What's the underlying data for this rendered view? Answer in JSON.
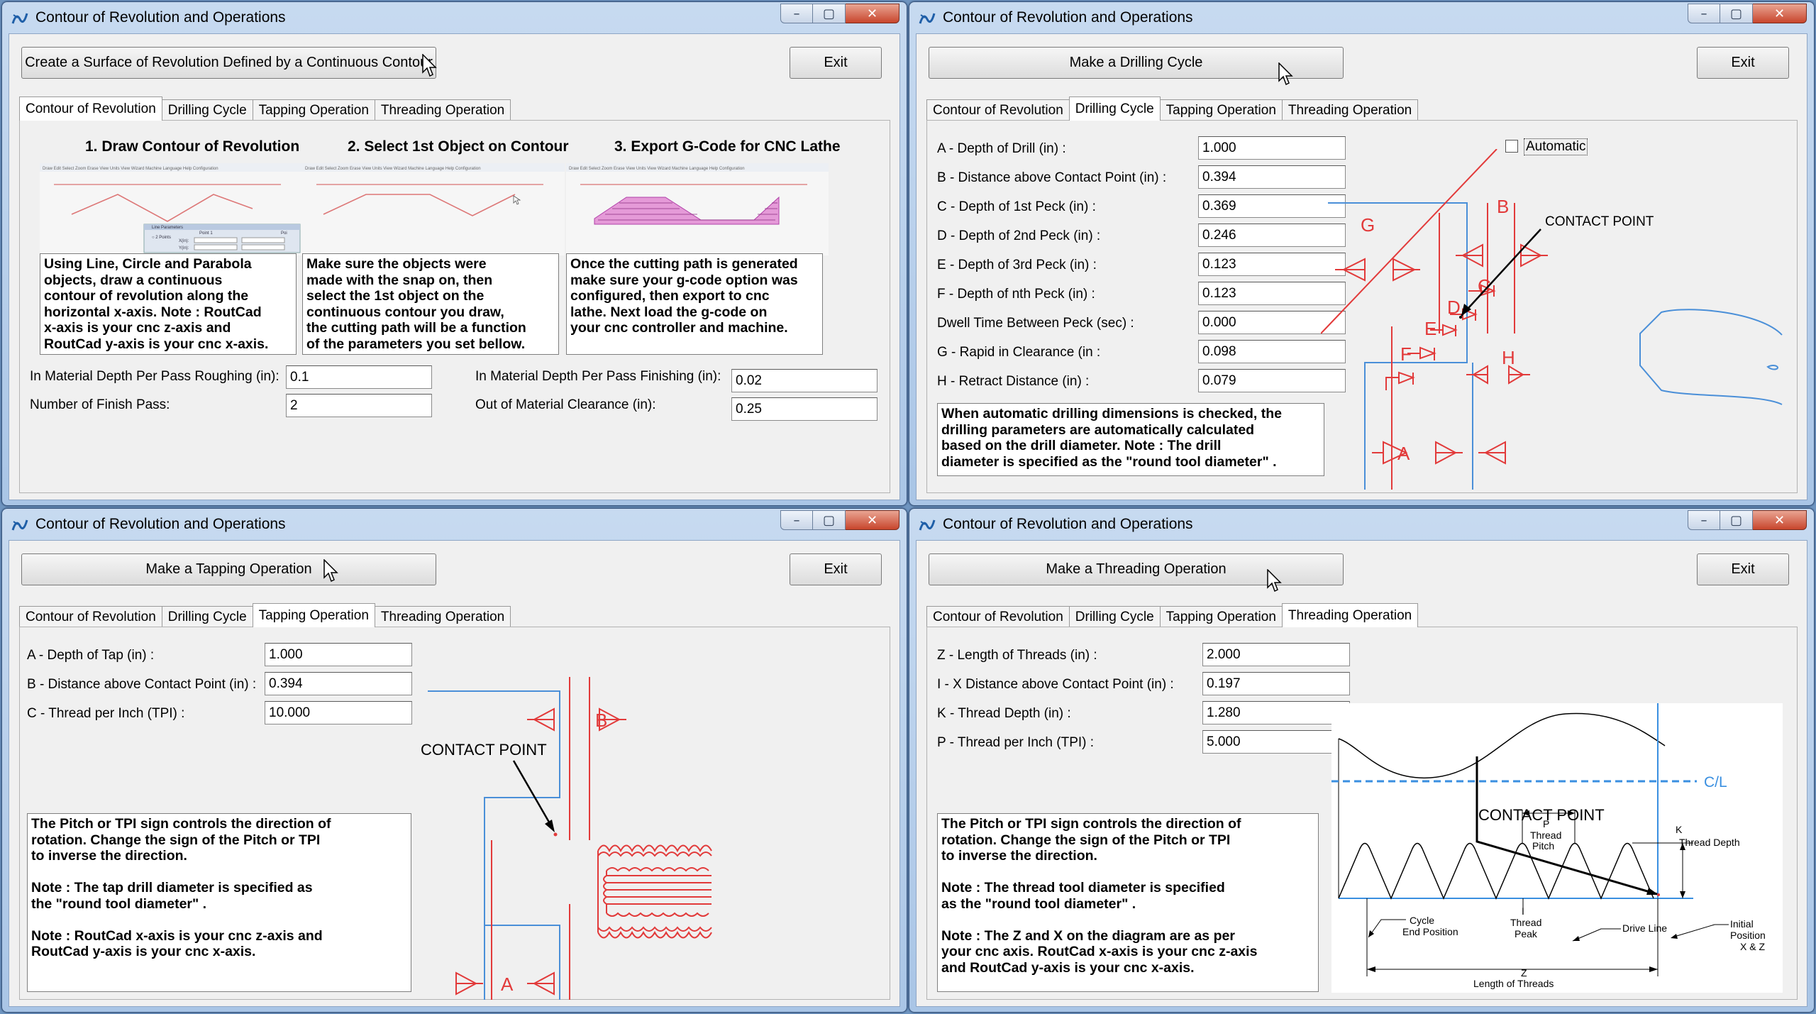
{
  "window_title": "Contour of Revolution and Operations",
  "window_controls": {
    "minimize": "–",
    "maximize": "▢",
    "close": "✕"
  },
  "tabs": [
    "Contour of Revolution",
    "Drilling Cycle",
    "Tapping Operation",
    "Threading Operation"
  ],
  "exit_label": "Exit",
  "contour": {
    "main_button": "Create a Surface of Revolution Defined by a Continuous Contour",
    "steps": [
      {
        "heading": "1. Draw Contour of Revolution",
        "text": "Using Line, Circle and Parabola\nobjects, draw a continuous\ncontour  of revolution along the\nhorizontal x-axis. Note : RoutCad\nx-axis is your cnc z-axis and\nRoutCad y-axis is your cnc x-axis."
      },
      {
        "heading": "2. Select 1st Object on Contour",
        "text": "Make sure the objects were\nmade with the snap on, then\nselect the 1st object on the\ncontinuous contour you draw,\nthe cutting path will be a function\nof the parameters you set bellow."
      },
      {
        "heading": "3. Export G-Code for CNC Lathe",
        "text": "Once the cutting path is generated\nmake sure your g-code option was\nconfigured, then export to cnc\nlathe. Next load the g-code on\nyour cnc controller and machine."
      }
    ],
    "menu_items": [
      "Draw",
      "Edit",
      "Select",
      "Zoom",
      "Erase",
      "View",
      "Units",
      "View",
      "Wizard",
      "Machine",
      "Language",
      "Help",
      "Configuration"
    ],
    "line_params": {
      "title": "Line Parameters",
      "option": "2 Points",
      "col1": "Point 1",
      "col2": "Poi",
      "xlabel": "X(in):",
      "ylabel": "Y(in):"
    },
    "fields": [
      {
        "label": "In Material Depth Per Pass Roughing (in):",
        "value": "0.1"
      },
      {
        "label": "Number of Finish Pass:",
        "value": "2"
      },
      {
        "label": "In Material Depth Per Pass Finishing (in):",
        "value": "0.02"
      },
      {
        "label": "Out of Material Clearance (in):",
        "value": "0.25"
      }
    ]
  },
  "drilling": {
    "main_button": "Make a Drilling Cycle",
    "fields": [
      {
        "label": "A - Depth of Drill  (in) :",
        "value": "1.000"
      },
      {
        "label": "B - Distance above Contact Point (in) :",
        "value": "0.394"
      },
      {
        "label": "C - Depth of 1st Peck (in) :",
        "value": "0.369"
      },
      {
        "label": "D - Depth of 2nd Peck (in) :",
        "value": "0.246"
      },
      {
        "label": "E - Depth of 3rd Peck (in) :",
        "value": "0.123"
      },
      {
        "label": "F - Depth of nth Peck (in) :",
        "value": "0.123"
      },
      {
        "label": "Dwell Time Between Peck (sec) :",
        "value": "0.000"
      },
      {
        "label": "G - Rapid in Clearance (in :",
        "value": "0.098"
      },
      {
        "label": "H - Retract Distance (in) :",
        "value": "0.079"
      }
    ],
    "automatic_label": "Automatic",
    "note": "When automatic drilling dimensions is checked, the\ndrilling parameters  are automatically calculated\nbased on the drill diameter.  Note : The drill\ndiameter is specified as the \"round tool diameter\" .",
    "diagram": {
      "contact": "CONTACT POINT",
      "A": "A",
      "B": "B",
      "C": "C",
      "D": "D",
      "E": "E",
      "F": "F",
      "G": "G",
      "H": "H"
    }
  },
  "tapping": {
    "main_button": "Make a Tapping Operation",
    "fields": [
      {
        "label": "A - Depth of Tap  (in) :",
        "value": "1.000"
      },
      {
        "label": "B - Distance above Contact Point (in) :",
        "value": "0.394"
      },
      {
        "label": "C - Thread per Inch (TPI) :",
        "value": "10.000"
      }
    ],
    "note": "The Pitch or TPI sign controls the direction of\nrotation. Change the sign of the Pitch or TPI\nto inverse the direction.\n\nNote : The tap drill diameter is specified as\nthe \"round tool diameter\" .\n\nNote : RoutCad x-axis is your cnc z-axis and\nRoutCad y-axis is your cnc x-axis.",
    "diagram": {
      "contact": "CONTACT POINT",
      "A": "A",
      "B": "B"
    }
  },
  "threading": {
    "main_button": "Make a Threading Operation",
    "fields": [
      {
        "label": "Z - Length of Threads  (in) :",
        "value": "2.000"
      },
      {
        "label": "I - X Distance above Contact Point (in) :",
        "value": "0.197"
      },
      {
        "label": "K - Thread Depth (in) :",
        "value": "1.280"
      },
      {
        "label": "P - Thread per Inch (TPI) :",
        "value": "5.000"
      }
    ],
    "note": "The Pitch or TPI sign controls the direction of\nrotation. Change the sign of the Pitch or TPI\nto inverse the direction.\n\nNote : The thread tool diameter is specified\nas the \"round tool diameter\" .\n\nNote : The Z and X on the diagram are as per\nyour cnc axis. RoutCad x-axis is your cnc z-axis\nand RoutCad y-axis is your cnc x-axis.",
    "diagram": {
      "cl": "C/L",
      "contact": "CONTACT POINT",
      "p1": "P",
      "p2": "Thread",
      "p3": "Pitch",
      "k1": "K",
      "k2": "Thread Depth",
      "i1": "I",
      "i2": "Thread",
      "i3": "Peak",
      "ce1": "Cycle",
      "ce2": "End Position",
      "drive": "Drive Line",
      "ip1": "Initial",
      "ip2": "Position",
      "ip3": "X & Z",
      "z1": "Z",
      "z2": "Length of Threads"
    }
  }
}
